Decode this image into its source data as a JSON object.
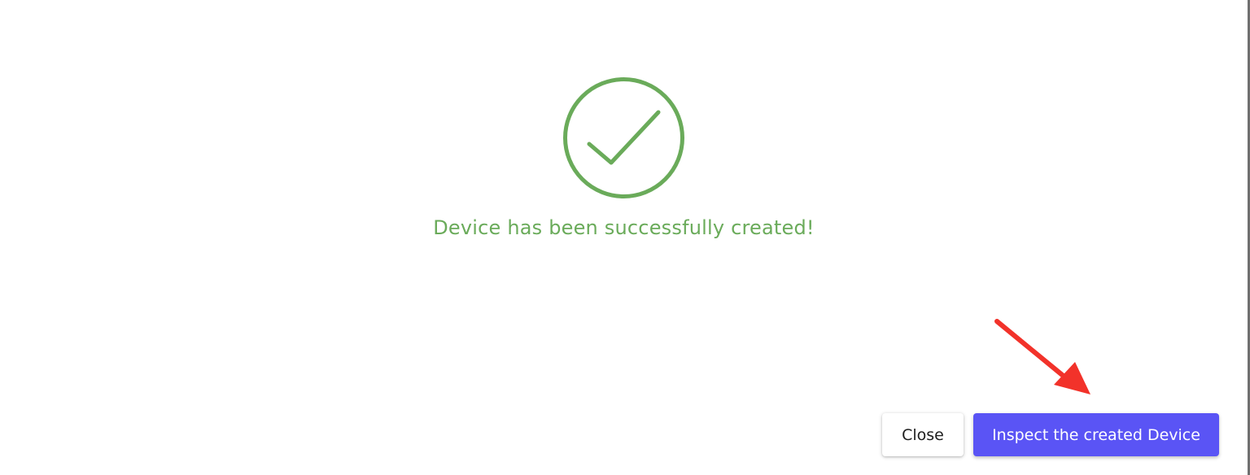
{
  "dialog": {
    "icon": "check-circle-icon",
    "message": "Device has been successfully created!",
    "message_color": "#6aab5a"
  },
  "actions": {
    "close_label": "Close",
    "inspect_label": "Inspect the created Device",
    "primary_color": "#5a54f5"
  },
  "annotation": {
    "icon": "red-arrow-icon",
    "color": "#f2322a"
  }
}
